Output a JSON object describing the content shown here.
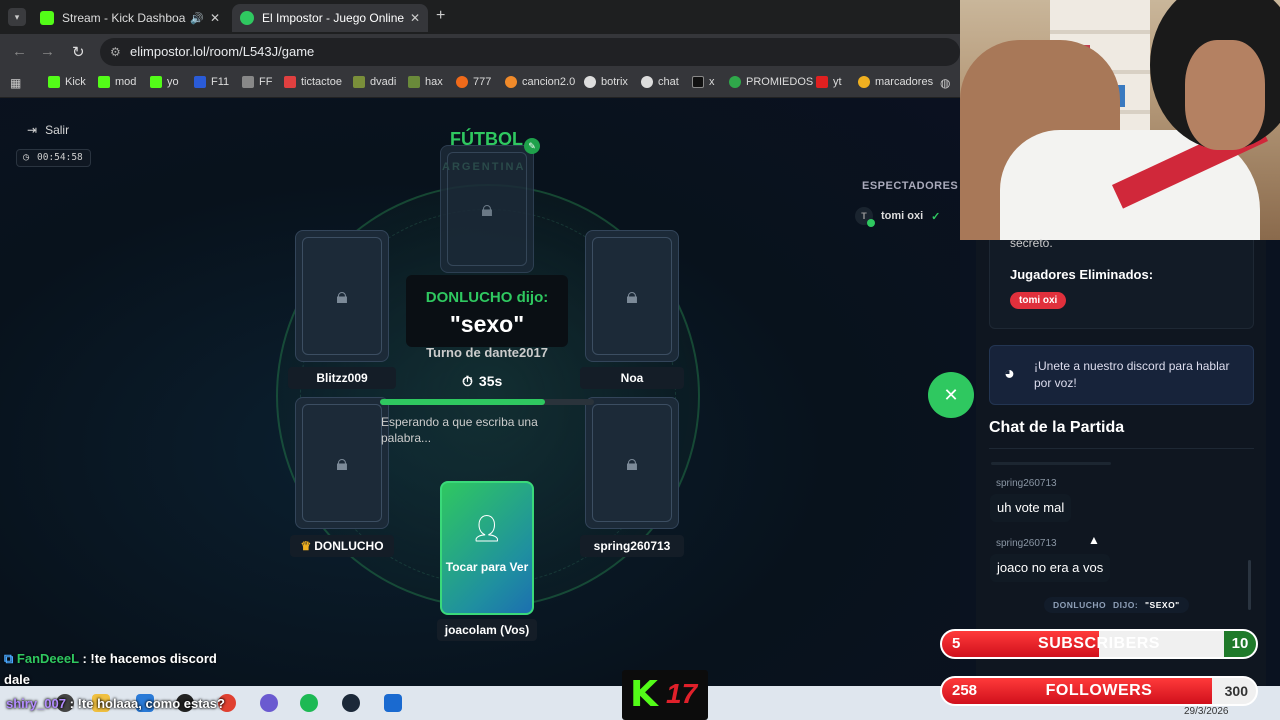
{
  "browser": {
    "tabs": [
      {
        "title": "Stream - Kick Dashboard",
        "color": "#53fc18"
      },
      {
        "title": "El Impostor - Juego Online Grat",
        "color": "#2fc860"
      }
    ],
    "url": "elimpostor.lol/room/L543J/game",
    "bookmarks": [
      "Kick",
      "mod",
      "yo",
      "F11",
      "FF",
      "tictactoe",
      "dvadi",
      "hax",
      "777",
      "cancion2.0",
      "botrix",
      "chat",
      "x",
      "PROMIEDOS",
      "yt",
      "marcadores"
    ]
  },
  "game": {
    "salir": "Salir",
    "timer": "00:54:58",
    "category": "FÚTBOL",
    "subcategory": "ARGENTINA",
    "players": {
      "p1": "Blitzz009",
      "p2": "Noa",
      "p3": "DONLUCHO",
      "p4": "spring260713",
      "me": "joacolam (Vos)"
    },
    "said_who": "DONLUCHO dijo:",
    "said_word": "\"sexo\"",
    "turn": "Turno de dante2017",
    "seconds": "35s",
    "progress_pct": 77,
    "waiting": "Esperando a que escriba una palabra...",
    "reveal": "Tocar para Ver",
    "spectators_title": "ESPECTADORES",
    "spectator_initial": "T",
    "spectator": "tomi oxi"
  },
  "sidebar": {
    "secret": "secreto.",
    "eliminated_title": "Jugadores Eliminados:",
    "eliminated": [
      "tomi oxi"
    ],
    "discord": "¡Unete a nuestro discord para hablar por voz!",
    "chat_title": "Chat de la Partida",
    "messages": [
      {
        "user": "spring260713",
        "text": "uh vote mal"
      },
      {
        "user": "spring260713",
        "text": "joaco no era a vos"
      }
    ],
    "system_who": "DONLUCHO",
    "system_said": "DIJO:",
    "system_word": "\"SEXO\""
  },
  "overlay": {
    "chat1_user": "FanDeeeL",
    "chat1_text": ": !te hacemos discord",
    "chat1_cont": "dale",
    "chat2_user": "shiry_007",
    "chat2_text": ": !te holaaa, como estas?",
    "subs_current": "5",
    "subs_label": "SUBSCRIBERS",
    "subs_target": "10",
    "follows_current": "258",
    "follows_label": "FOLLOWERS",
    "follows_target": "300",
    "subs_fraction": 0.5,
    "follows_fraction": 0.86,
    "date": "29/3/2026"
  }
}
